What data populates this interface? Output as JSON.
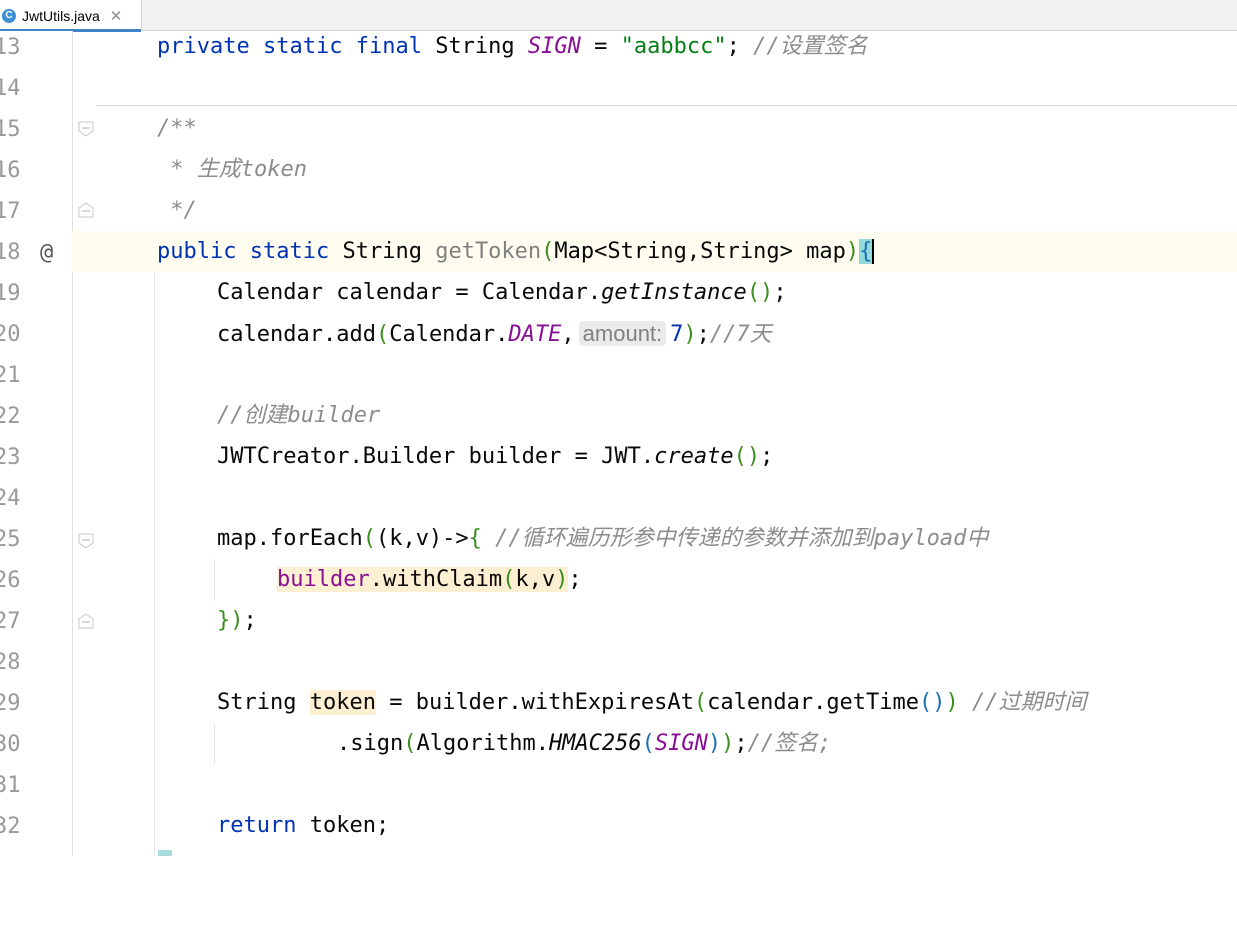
{
  "tab": {
    "icon": "java-class-icon",
    "icon_letter": "C",
    "title": "JwtUtils.java",
    "close": "✕"
  },
  "gutter": {
    "line_numbers": [
      "13",
      "14",
      "15",
      "16",
      "17",
      "18",
      "19",
      "20",
      "21",
      "22",
      "23",
      "24",
      "25",
      "26",
      "27",
      "28",
      "29",
      "30",
      "31",
      "32"
    ],
    "annotation_marker": "@"
  },
  "code": {
    "l13": {
      "k1": "private",
      "k2": "static",
      "k3": "final",
      "type": "String",
      "const": "SIGN",
      "eq": " = ",
      "str": "\"aabbcc\"",
      "semi": "; ",
      "cmt": "//设置签名"
    },
    "l15": {
      "cmt": "/**"
    },
    "l16": {
      "cmt": " * 生成token"
    },
    "l17": {
      "cmt": " */"
    },
    "l18": {
      "k1": "public",
      "k2": "static",
      "type": "String",
      "name": "getToken",
      "p1": "(",
      "params": "Map<String,String> map",
      "p2": ")",
      "brace": "{"
    },
    "l19": {
      "a": "Calendar calendar = Calendar.",
      "m": "getInstance",
      "p": "()",
      "e": ";"
    },
    "l20": {
      "a": "calendar.add",
      "p1": "(",
      "b": "Calendar.",
      "c": "DATE",
      "d": ",",
      "hint": "amount:",
      "n": "7",
      "p2": ")",
      "e": ";",
      "cmt": "//7天"
    },
    "l22": {
      "cmt": "//创建builder"
    },
    "l23": {
      "a": "JWTCreator.Builder builder = JWT.",
      "m": "create",
      "p": "()",
      "e": ";"
    },
    "l25": {
      "a": "map.forEach",
      "p1": "(",
      "b": "(k,v)->",
      "br": "{",
      "sp": " ",
      "cmt": "//循环遍历形参中传递的参数并添加到payload中"
    },
    "l26": {
      "a": "builder",
      "b": ".withClaim",
      "p1": "(",
      "c": "k,v",
      "p2": ")",
      "e": ";"
    },
    "l27": {
      "br": "}",
      "p": ")",
      "e": ";"
    },
    "l29": {
      "type": "String",
      "sp": " ",
      "var": "token",
      "a": " = builder.withExpiresAt",
      "p1": "(",
      "b": "calendar.getTime",
      "p2": "()",
      "p3": ")",
      "sp2": " ",
      "cmt": "//过期时间"
    },
    "l30": {
      "a": ".sign",
      "p1": "(",
      "b": "Algorithm.",
      "m": "HMAC256",
      "p2": "(",
      "c": "SIGN",
      "p3": ")",
      "p4": ")",
      "e": ";",
      "cmt": "//签名;"
    },
    "l32": {
      "kw": "return",
      "rest": " token;"
    }
  },
  "colors": {
    "keyword": "#0033b3",
    "string": "#067d17",
    "comment": "#8c8c8c",
    "constant": "#871094",
    "current_line": "#fefdef"
  }
}
